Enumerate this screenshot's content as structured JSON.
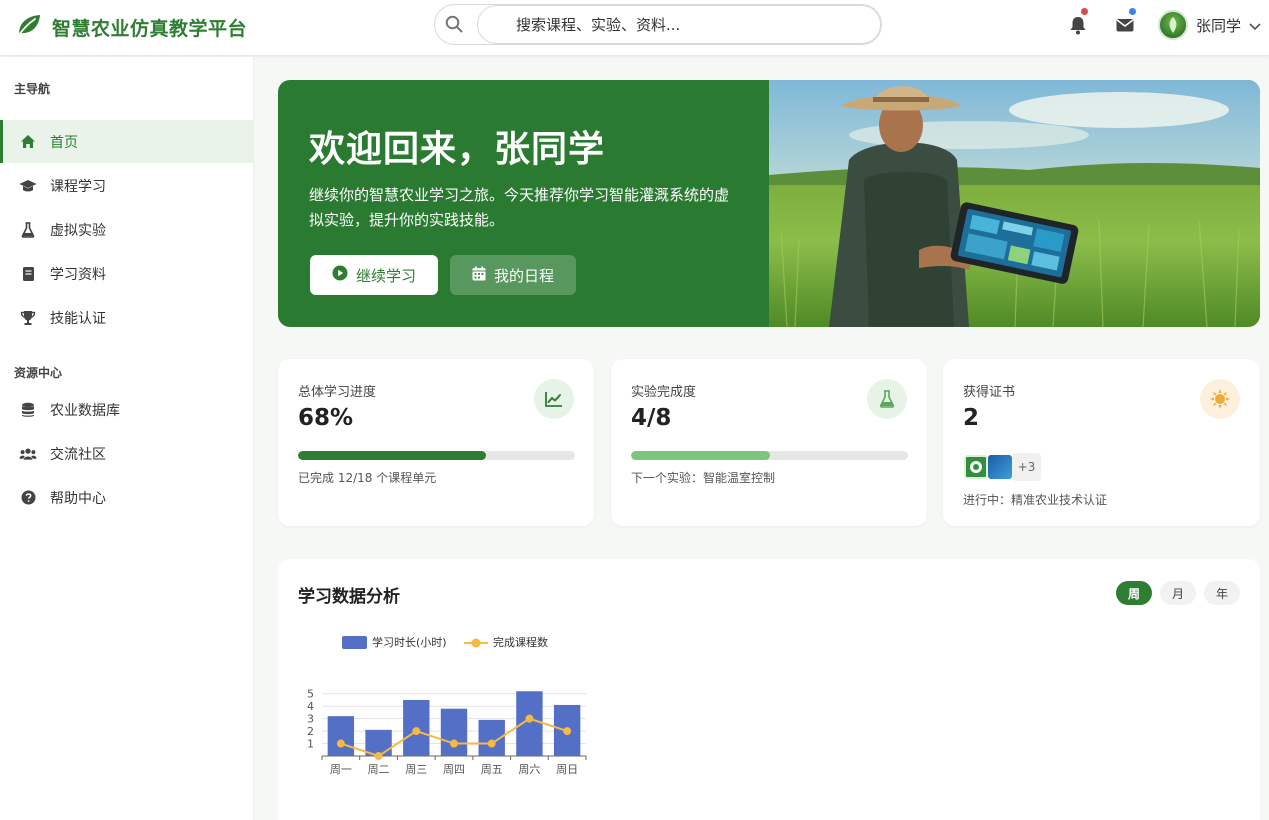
{
  "app": {
    "title": "智慧农业仿真教学平台"
  },
  "search": {
    "placeholder": "搜索课程、实验、资料..."
  },
  "header": {
    "notification_icon": "bell-icon",
    "message_icon": "envelope-icon",
    "user_name": "张同学",
    "colors": {
      "notif_dot": "#e04848",
      "msg_dot": "#3b82f6"
    }
  },
  "sidebar": {
    "main_label": "主导航",
    "main_items": [
      {
        "label": "首页",
        "icon": "home-icon",
        "active": true
      },
      {
        "label": "课程学习",
        "icon": "graduation-cap-icon"
      },
      {
        "label": "虚拟实验",
        "icon": "flask-icon"
      },
      {
        "label": "学习资料",
        "icon": "book-icon"
      },
      {
        "label": "技能认证",
        "icon": "trophy-icon"
      }
    ],
    "resource_label": "资源中心",
    "resource_items": [
      {
        "label": "农业数据库",
        "icon": "database-icon"
      },
      {
        "label": "交流社区",
        "icon": "users-icon"
      },
      {
        "label": "帮助中心",
        "icon": "question-circle-icon"
      }
    ]
  },
  "banner": {
    "title": "欢迎回来，张同学",
    "text": "继续你的智慧农业学习之旅。今天推荐你学习智能灌溉系统的虚拟实验，提升你的实践技能。",
    "primary_button": "继续学习",
    "secondary_button": "我的日程",
    "image": "farmer-with-tablet-in-wheat-field"
  },
  "stats": {
    "progress": {
      "label": "总体学习进度",
      "value": "68%",
      "fraction": 0.68,
      "note": "已完成 12/18 个课程单元",
      "icon": "chart-line-icon"
    },
    "experiments": {
      "label": "实验完成度",
      "value": "4/8",
      "fraction": 0.5,
      "note": "下一个实验：智能温室控制",
      "icon": "flask-icon"
    },
    "certificates": {
      "label": "获得证书",
      "value": "2",
      "more": "+3",
      "note": "进行中：精准农业技术认证",
      "icon": "certificate-sun-icon"
    }
  },
  "analytics": {
    "title": "学习数据分析",
    "ranges": [
      "周",
      "月",
      "年"
    ],
    "active_range": "周"
  },
  "chart_data": {
    "type": "bar",
    "categories": [
      "周一",
      "周二",
      "周三",
      "周四",
      "周五",
      "周六",
      "周日"
    ],
    "series": [
      {
        "name": "学习时长(小时)",
        "type": "bar",
        "color": "#5470c6",
        "values": [
          3.2,
          2.1,
          4.5,
          3.8,
          2.9,
          5.2,
          4.1
        ]
      },
      {
        "name": "完成课程数",
        "type": "line",
        "color": "#f5b944",
        "values": [
          1,
          0,
          2,
          1,
          1,
          3,
          2
        ]
      }
    ],
    "y_ticks": [
      "1",
      "2",
      "3",
      "4",
      "5"
    ],
    "ylim": [
      0,
      5.3
    ],
    "legend": "top",
    "grid": true
  }
}
